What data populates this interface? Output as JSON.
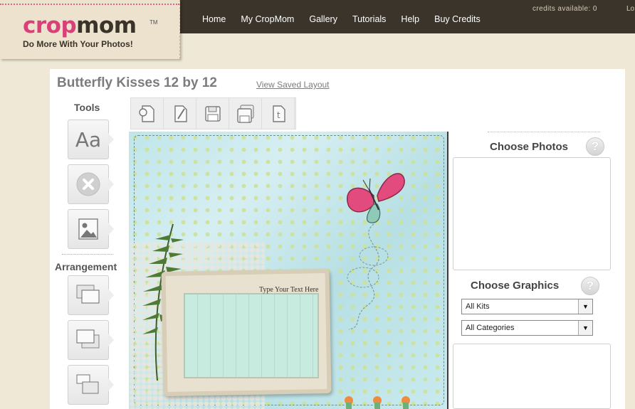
{
  "header": {
    "logo_crop": "crop",
    "logo_mom": "mom",
    "logo_tm": "TM",
    "tagline": "Do More With Your Photos!",
    "nav": [
      "Home",
      "My CropMom",
      "Gallery",
      "Tutorials",
      "Help",
      "Buy Credits"
    ],
    "credits": "credits available: 0",
    "logout_fragment": "Lo"
  },
  "page": {
    "title": "Butterfly Kisses 12 by 12",
    "view_saved": "View Saved Layout"
  },
  "left_tools": {
    "tools_label": "Tools",
    "text_tool_glyph": "Aa",
    "arrangement_label": "Arrangement"
  },
  "canvas": {
    "caption": "Type Your Text Here"
  },
  "right_panel": {
    "choose_photos": "Choose Photos",
    "choose_graphics": "Choose Graphics",
    "help_glyph": "?",
    "kits_select": "All Kits",
    "categories_select": "All Categories"
  },
  "colors": {
    "topbar": "#3b342b",
    "brand_pink": "#d9407a",
    "page_bg": "#efe8d6"
  }
}
